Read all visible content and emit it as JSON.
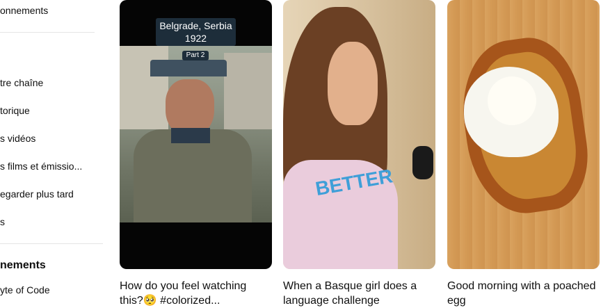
{
  "sidebar": {
    "items": [
      {
        "label": "onnements"
      },
      {
        "label": "tre chaîne"
      },
      {
        "label": "torique"
      },
      {
        "label": "s vidéos"
      },
      {
        "label": "s films et émissio..."
      },
      {
        "label": "egarder plus tard"
      },
      {
        "label": "s"
      }
    ],
    "section_title": "nements",
    "subscriptions": [
      {
        "label": "yte of Code"
      }
    ]
  },
  "shorts": [
    {
      "title": "How do you feel watching this?🥺  #colorized...",
      "overlay_caption_line1": "Belgrade, Serbia",
      "overlay_caption_line2": "1922",
      "overlay_part": "Part 2"
    },
    {
      "title": "When a Basque girl does a language challenge",
      "shirt_text": "BETTER"
    },
    {
      "title": "Good morning with a poached egg"
    }
  ]
}
